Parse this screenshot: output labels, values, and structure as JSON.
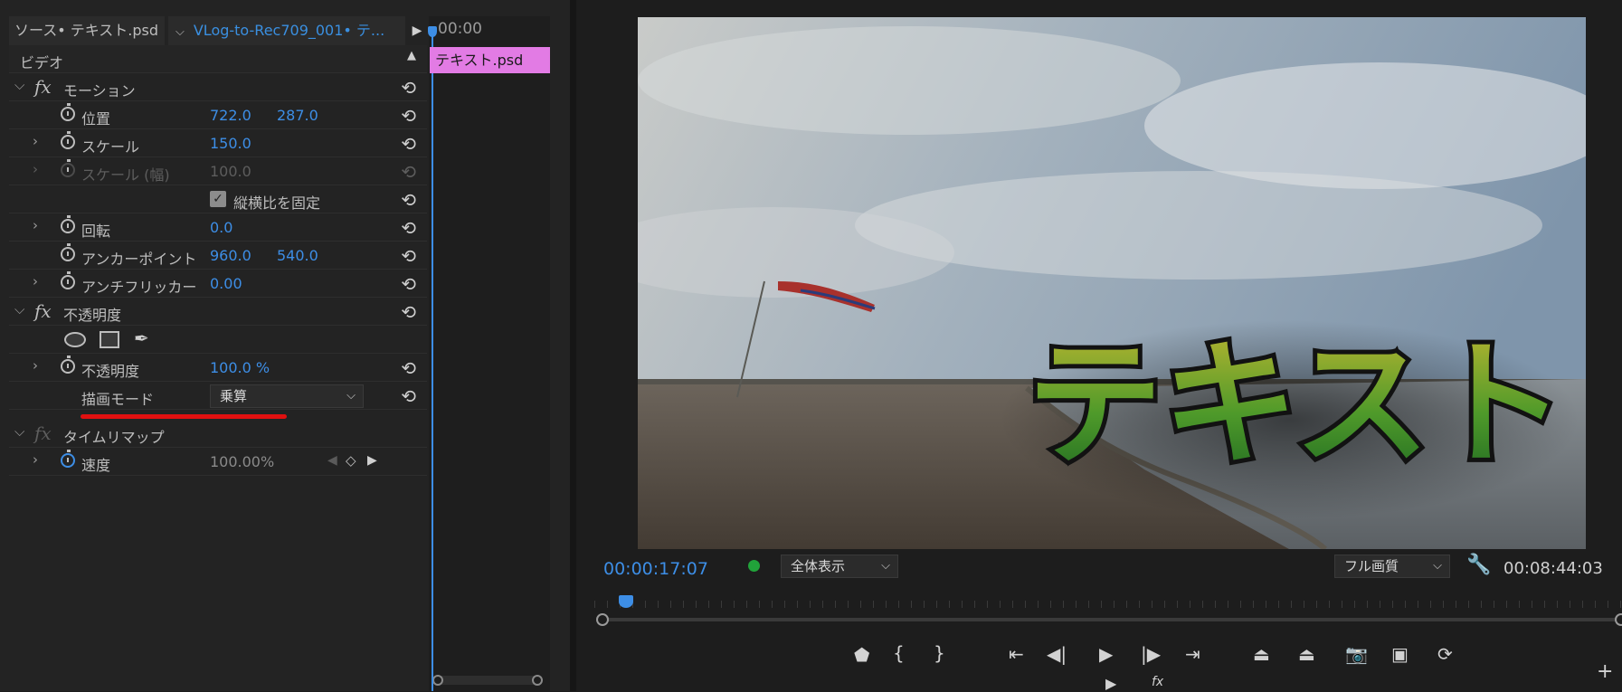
{
  "tabs": {
    "source": "ソース• テキスト.psd",
    "effect_controls": "VLog-to-Rec709_001• テ...",
    "timecode": "00:00"
  },
  "effect_controls": {
    "category": "ビデオ",
    "motion": {
      "title": "モーション",
      "position": {
        "label": "位置",
        "x": "722.0",
        "y": "287.0"
      },
      "scale": {
        "label": "スケール",
        "value": "150.0"
      },
      "scale_width": {
        "label": "スケール (幅)",
        "value": "100.0"
      },
      "uniform_scale": {
        "label": "縦横比を固定",
        "checked": true
      },
      "rotation": {
        "label": "回転",
        "value": "0.0"
      },
      "anchor": {
        "label": "アンカーポイント",
        "x": "960.0",
        "y": "540.0"
      },
      "antiflicker": {
        "label": "アンチフリッカー",
        "value": "0.00"
      }
    },
    "opacity": {
      "title": "不透明度",
      "opacity": {
        "label": "不透明度",
        "value": "100.0 %"
      },
      "blend_mode": {
        "label": "描画モード",
        "value": "乗算"
      }
    },
    "time_remap": {
      "title": "タイムリマップ",
      "speed": {
        "label": "速度",
        "value": "100.00%"
      }
    },
    "clip_label": "テキスト.psd"
  },
  "program": {
    "current_time": "00:00:17:07",
    "zoom": "全体表示",
    "quality": "フル画質",
    "duration": "00:08:44:03",
    "overlay_text": "テキスト"
  },
  "colors": {
    "accent": "#3d8ee6",
    "clip": "#e27be4",
    "annotation": "#e01010",
    "status": "#21a33a"
  }
}
